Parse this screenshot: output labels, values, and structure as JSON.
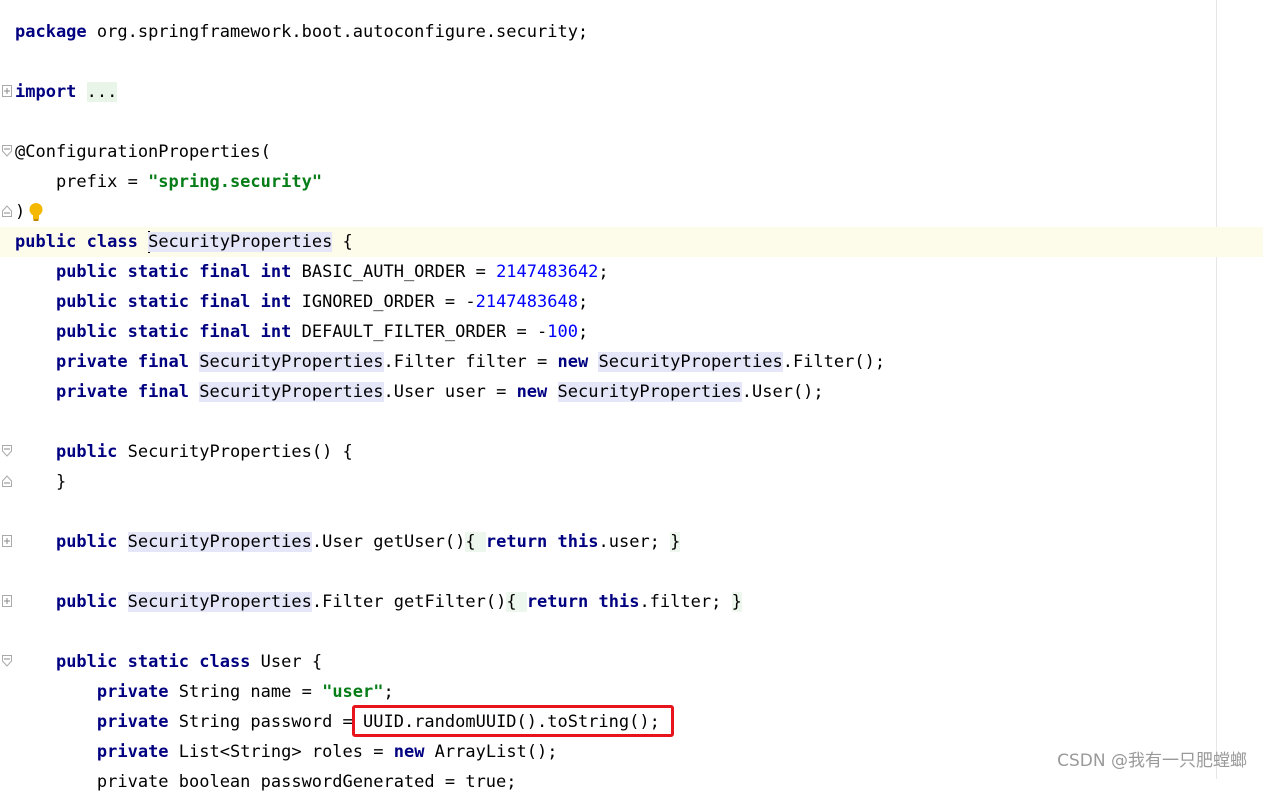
{
  "editor": {
    "lines": {
      "l1": {
        "kw": "package",
        "rest": " org.springframework.boot.autoconfigure.security;"
      },
      "l3": {
        "kw": "import",
        "folded": "..."
      },
      "l5": {
        "text": "@ConfigurationProperties("
      },
      "l6": {
        "pre": "    prefix = ",
        "str": "\"spring.security\""
      },
      "l7": {
        "text": ")"
      },
      "l8": {
        "kw": "public class",
        "cls": "SecurityProperties",
        "rest": " {"
      },
      "l9": {
        "kw": "public static final int",
        "rest": " BASIC_AUTH_ORDER = ",
        "num": "2147483642",
        "end": ";"
      },
      "l10": {
        "kw": "public static final int",
        "rest": " IGNORED_ORDER = -",
        "num": "2147483648",
        "end": ";"
      },
      "l11": {
        "kw": "public static final int",
        "rest": " DEFAULT_FILTER_ORDER = -",
        "num": "100",
        "end": ";"
      },
      "l12": {
        "kw": "private final",
        "ref1": "SecurityProperties",
        "mid": ".Filter filter = ",
        "kw2": "new",
        "ref2": "SecurityProperties",
        "end": ".Filter();"
      },
      "l13": {
        "kw": "private final",
        "ref1": "SecurityProperties",
        "mid": ".User user = ",
        "kw2": "new",
        "ref2": "SecurityProperties",
        "end": ".User();"
      },
      "l15": {
        "kw": "public",
        "rest": " SecurityProperties() {"
      },
      "l16": {
        "text": "    }"
      },
      "l18": {
        "kw": "public",
        "ref": "SecurityProperties",
        "mid": ".User getUser()",
        "ob": "{ ",
        "kw2": "return",
        "kw3": "this",
        "end": ".user; ",
        "cb": "}"
      },
      "l20": {
        "kw": "public",
        "ref": "SecurityProperties",
        "mid": ".Filter getFilter()",
        "ob": "{ ",
        "kw2": "return",
        "kw3": "this",
        "end": ".filter; ",
        "cb": "}"
      },
      "l22": {
        "kw": "public static class",
        "rest": " User {"
      },
      "l23": {
        "kw": "private",
        "mid": " String name = ",
        "str": "\"user\"",
        "end": ";"
      },
      "l24": {
        "kw": "private",
        "mid": " String password = ",
        "rest": "UUID.randomUUID().toString();"
      },
      "l25": {
        "kw": "private",
        "mid": " List<String> roles = ",
        "kw2": "new",
        "end": " ArrayList();"
      },
      "l26": {
        "partial": "        private boolean passwordGenerated = true;"
      }
    }
  },
  "watermark": "CSDN @我有一只肥螳螂",
  "colors": {
    "keyword": "#000080",
    "string": "#067d17",
    "number": "#0000ff",
    "highlight_box": "#e8141b"
  }
}
